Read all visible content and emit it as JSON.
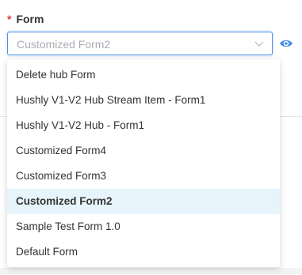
{
  "form_field": {
    "required_marker": "*",
    "label": "Form",
    "selected_value": "Customized Form2",
    "chevron_icon": "chevron-down-icon",
    "preview_icon": "eye-icon"
  },
  "dropdown": {
    "options": [
      {
        "label": "Delete hub Form",
        "selected": false
      },
      {
        "label": "Hushly V1-V2 Hub Stream Item - Form1",
        "selected": false
      },
      {
        "label": "Hushly V1-V2 Hub - Form1",
        "selected": false
      },
      {
        "label": "Customized Form4",
        "selected": false
      },
      {
        "label": "Customized Form3",
        "selected": false
      },
      {
        "label": "Customized Form2",
        "selected": true
      },
      {
        "label": "Sample Test Form 1.0",
        "selected": false
      },
      {
        "label": "Default Form",
        "selected": false
      }
    ]
  },
  "colors": {
    "accent": "#4a90e2",
    "required": "#e53935",
    "selected_bg": "#e7f4fb"
  }
}
